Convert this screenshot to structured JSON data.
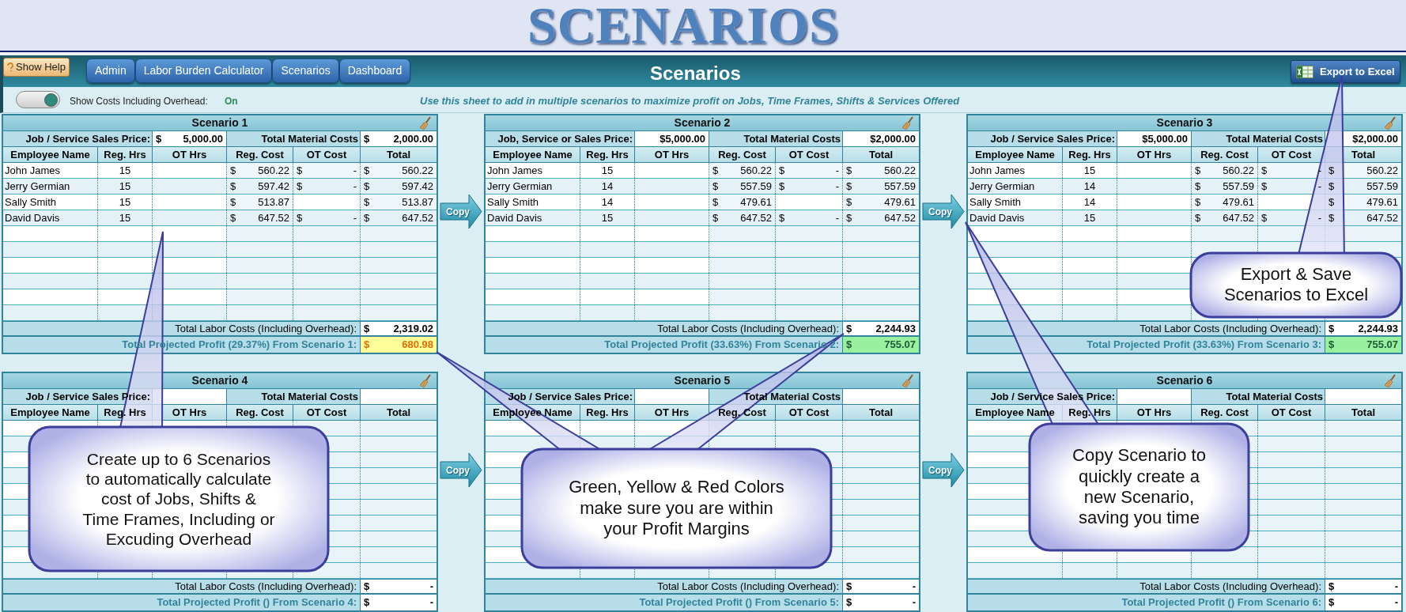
{
  "banner": "SCENARIOS",
  "help_button": "Show Help",
  "nav_tabs": [
    {
      "label": "Admin"
    },
    {
      "label": "Labor Burden Calculator"
    },
    {
      "label": "Scenarios"
    },
    {
      "label": "Dashboard"
    }
  ],
  "title": "Scenarios",
  "export_button": "Export to Excel",
  "overhead_toggle": {
    "label": "Show Costs Including Overhead:",
    "value": "On",
    "on": true
  },
  "instruction": "Use this sheet to add in multiple scenarios to maximize profit on Jobs, Time Frames, Shifts & Services Offered",
  "scenarios": [
    {
      "title": "Scenario 1",
      "columns": [
        "Employee Name",
        "Reg. Hrs",
        "OT Hrs",
        "Reg. Cost",
        "OT Cost",
        "Total"
      ],
      "price_label": "Job / Service Sales Price:",
      "price": [
        "$",
        "5,000.00"
      ],
      "material_label": "Total Material Costs",
      "material": [
        "$",
        "2,000.00"
      ],
      "rows": [
        {
          "name": "John James",
          "reg_hrs": "15",
          "reg_cost": [
            "$",
            "560.22"
          ],
          "ot_cost": [
            "$",
            "-"
          ],
          "total": [
            "$",
            "560.22"
          ]
        },
        {
          "name": "Jerry Germian",
          "reg_hrs": "15",
          "reg_cost": [
            "$",
            "597.42"
          ],
          "ot_cost": [
            "$",
            "-"
          ],
          "total": [
            "$",
            "597.42"
          ]
        },
        {
          "name": "Sally Smith",
          "reg_hrs": "15",
          "reg_cost": [
            "$",
            "513.87"
          ],
          "total": [
            "$",
            "513.87"
          ]
        },
        {
          "name": "David Davis",
          "reg_hrs": "15",
          "reg_cost": [
            "$",
            "647.52"
          ],
          "ot_cost": [
            "$",
            "-"
          ],
          "total": [
            "$",
            "647.52"
          ]
        }
      ],
      "labor_label": "Total Labor Costs (Including Overhead):",
      "labor": [
        "$",
        "2,319.02"
      ],
      "profit": {
        "label": "Total Projected Profit (29.37%) From Scenario 1:",
        "value": [
          "$",
          "680.98"
        ],
        "color": "#ffff99"
      }
    },
    {
      "title": "Scenario 2",
      "columns": [
        "Employee Name",
        "Reg. Hrs",
        "OT Hrs",
        "Reg. Cost",
        "OT Cost",
        "Total"
      ],
      "price_label": "Job, Service or Sales Price:",
      "price": [
        "$5,000.00"
      ],
      "material_label": "Total Material Costs",
      "material": [
        "$2,000.00"
      ],
      "rows": [
        {
          "name": "John James",
          "reg_hrs": "15",
          "reg_cost": [
            "$",
            "560.22"
          ],
          "ot_cost": [
            "$",
            "-"
          ],
          "total": [
            "$",
            "560.22"
          ]
        },
        {
          "name": "Jerry Germian",
          "reg_hrs": "14",
          "reg_cost": [
            "$",
            "557.59"
          ],
          "ot_cost": [
            "$",
            "-"
          ],
          "total": [
            "$",
            "557.59"
          ]
        },
        {
          "name": "Sally Smith",
          "reg_hrs": "14",
          "reg_cost": [
            "$",
            "479.61"
          ],
          "total": [
            "$",
            "479.61"
          ]
        },
        {
          "name": "David Davis",
          "reg_hrs": "15",
          "reg_cost": [
            "$",
            "647.52"
          ],
          "ot_cost": [
            "$",
            "-"
          ],
          "total": [
            "$",
            "647.52"
          ]
        }
      ],
      "labor_label": "Total Labor Costs (Including Overhead):",
      "labor": [
        "$",
        "2,244.93"
      ],
      "profit": {
        "label": "Total Projected Profit (33.63%) From Scenario 2:",
        "value": [
          "$",
          "755.07"
        ],
        "color": "#99f09f"
      }
    },
    {
      "title": "Scenario 3",
      "columns": [
        "Employee Name",
        "Reg. Hrs",
        "OT Hrs",
        "Reg. Cost",
        "OT Cost",
        "Total"
      ],
      "price_label": "Job / Service Sales Price:",
      "price": [
        "$5,000.00"
      ],
      "material_label": "Total Material Costs",
      "material": [
        "$2,000.00"
      ],
      "rows": [
        {
          "name": "John James",
          "reg_hrs": "15",
          "reg_cost": [
            "$",
            "560.22"
          ],
          "ot_cost": [
            "$",
            "-"
          ],
          "total": [
            "$",
            "560.22"
          ]
        },
        {
          "name": "Jerry Germian",
          "reg_hrs": "14",
          "reg_cost": [
            "$",
            "557.59"
          ],
          "ot_cost": [
            "$",
            "-"
          ],
          "total": [
            "$",
            "557.59"
          ]
        },
        {
          "name": "Sally Smith",
          "reg_hrs": "14",
          "reg_cost": [
            "$",
            "479.61"
          ],
          "total": [
            "$",
            "479.61"
          ]
        },
        {
          "name": "David Davis",
          "reg_hrs": "15",
          "reg_cost": [
            "$",
            "647.52"
          ],
          "ot_cost": [
            "$",
            "-"
          ],
          "total": [
            "$",
            "647.52"
          ]
        }
      ],
      "labor_label": "Total Labor Costs (Including Overhead):",
      "labor": [
        "$",
        "2,244.93"
      ],
      "profit": {
        "label": "Total Projected Profit (33.63%) From Scenario 3:",
        "value": [
          "$",
          "755.07"
        ],
        "color": "#99f09f"
      }
    },
    {
      "title": "Scenario 4",
      "columns": [
        "Employee Name",
        "Reg. Hrs",
        "OT Hrs",
        "Reg. Cost",
        "OT Cost",
        "Total"
      ],
      "price_label": "Job / Service Sales Price:",
      "material_label": "Total Material Costs",
      "labor_label": "Total Labor Costs (Including Overhead):",
      "labor": [
        "$",
        "-"
      ],
      "profit": {
        "label": "Total Projected Profit () From Scenario 4:",
        "value": [
          "$",
          "-"
        ]
      }
    },
    {
      "title": "Scenario 5",
      "columns": [
        "Employee Name",
        "Reg. Hrs",
        "OT Hrs",
        "Reg. Cost",
        "OT Cost",
        "Total"
      ],
      "price_label": "Job / Service Sales Price:",
      "material_label": "Total Material Costs",
      "labor_label": "Total Labor Costs (Including Overhead):",
      "labor": [
        "$",
        "-"
      ],
      "profit": {
        "label": "Total Projected Profit () From Scenario 5:",
        "value": [
          "$",
          "-"
        ]
      }
    },
    {
      "title": "Scenario 6",
      "columns": [
        "Employee Name",
        "Reg. Hrs",
        "OT Hrs",
        "Reg. Cost",
        "OT Cost",
        "Total"
      ],
      "price_label": "Job / Service Sales Price:",
      "material_label": "Total Material Costs",
      "labor_label": "Total Labor Costs (Including Overhead):",
      "labor": [
        "$",
        "-"
      ],
      "profit": {
        "label": "Total Projected Profit () From Scenario 6:",
        "value": [
          "$",
          "-"
        ]
      }
    }
  ],
  "copy_buttons": [
    "Copy",
    "Copy",
    "Copy",
    "Copy"
  ],
  "callouts": [
    {
      "lines": [
        "Create up to 6 Scenarios",
        "to automatically calculate",
        "cost of Jobs, Shifts &",
        "Time Frames, Including or",
        "Excuding Overhead"
      ]
    },
    {
      "lines": [
        "Green, Yellow & Red Colors",
        "make sure you are within",
        "your Profit Margins"
      ]
    },
    {
      "lines": [
        "Copy Scenario to",
        "quickly create a",
        "new Scenario,",
        "saving you time"
      ]
    },
    {
      "lines": [
        "Export & Save",
        "Scenarios to Excel"
      ]
    }
  ]
}
